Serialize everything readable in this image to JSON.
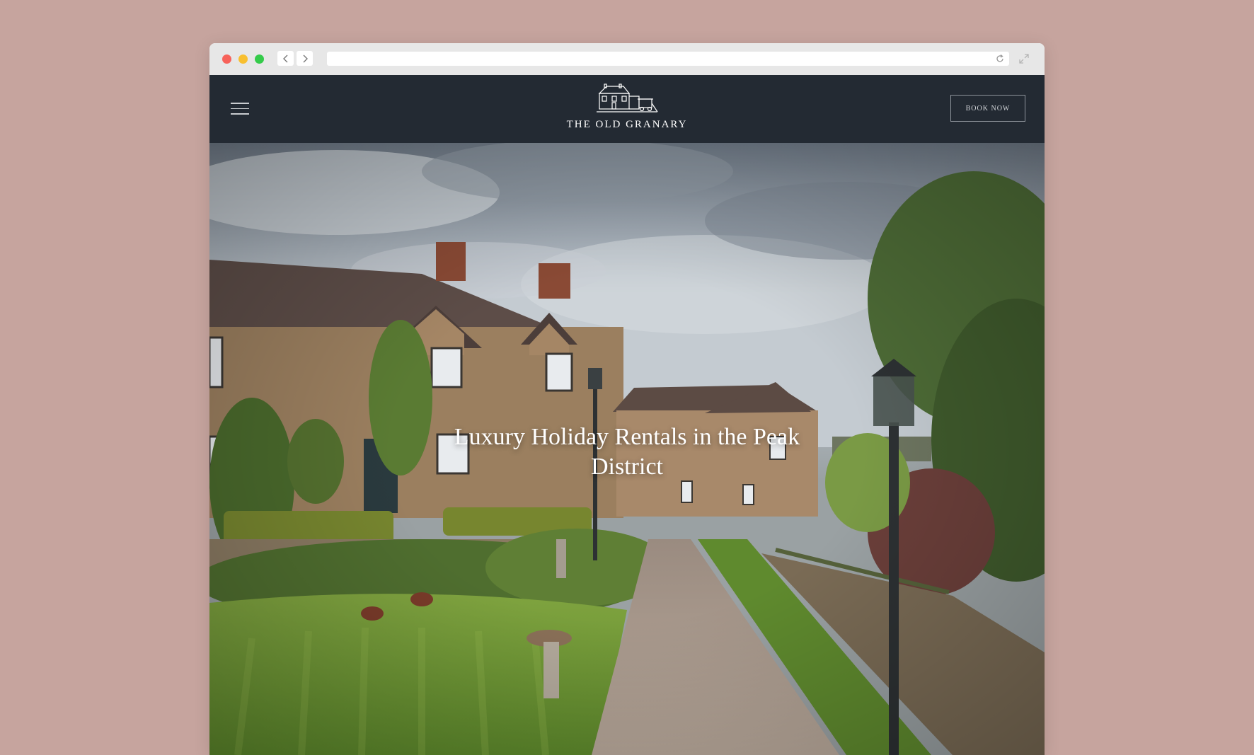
{
  "browser": {
    "url": ""
  },
  "header": {
    "logo_text": "THE OLD GRANARY",
    "book_button": "BOOK NOW"
  },
  "hero": {
    "title": "Luxury Holiday Rentals in the Peak District"
  },
  "icons": {
    "menu": "hamburger-icon",
    "back": "chevron-left-icon",
    "forward": "chevron-right-icon",
    "reload": "reload-icon",
    "expand": "expand-icon",
    "logo": "cottage-logo-icon"
  },
  "colors": {
    "page_background": "#c6a49e",
    "header_background": "#232a33"
  }
}
